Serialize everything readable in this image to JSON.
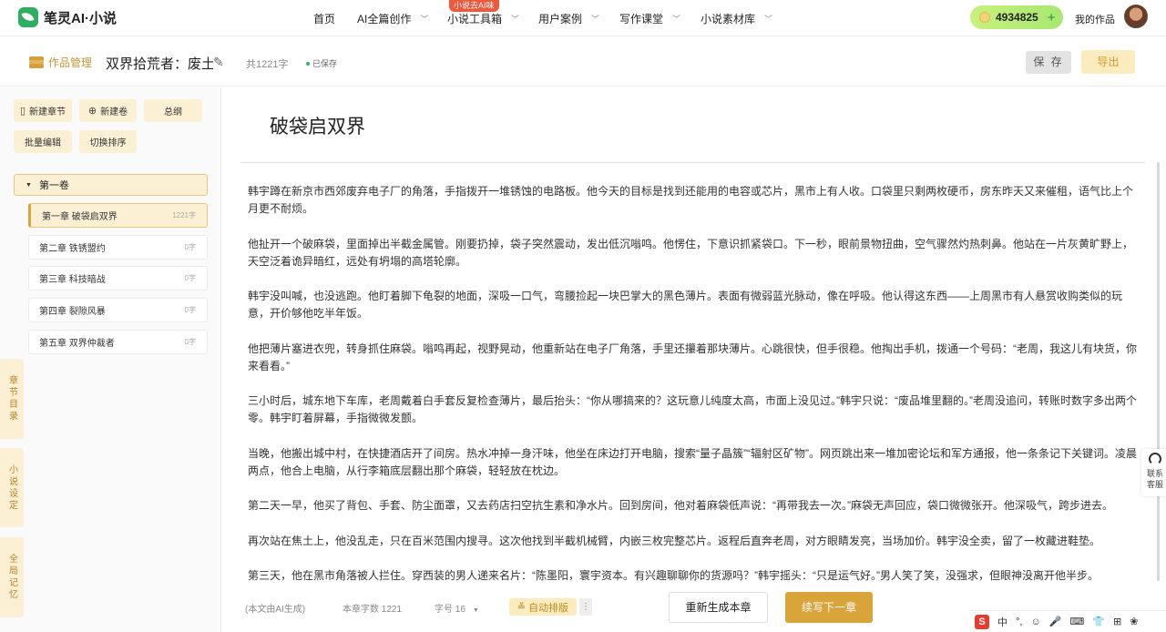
{
  "app": {
    "name": "笔灵AI·小说"
  },
  "nav": {
    "items": [
      {
        "label": "首页"
      },
      {
        "label": "AI全篇创作"
      },
      {
        "label": "小说工具箱"
      },
      {
        "label": "用户案例"
      },
      {
        "label": "写作课堂"
      },
      {
        "label": "小说素材库"
      }
    ],
    "badge": "小说去AI味",
    "coins": "4934825",
    "my_works": "我的作品"
  },
  "toolbar": {
    "works_manager": "作品管理",
    "doc_title": "双界拾荒者：废土商",
    "word_total": "共1221字",
    "saved": "已保存",
    "save": "保 存",
    "export": "导出"
  },
  "sidebar": {
    "buttons": {
      "new_chapter": "新建章节",
      "new_volume": "新建卷",
      "outline": "总纲",
      "batch_edit": "批量编辑",
      "toggle_sort": "切换排序"
    },
    "volume": "第一卷",
    "chapters": [
      {
        "name": "第一章 破袋启双界",
        "count": "1221字"
      },
      {
        "name": "第二章 铁锈盟约",
        "count": "0字"
      },
      {
        "name": "第三章 科技暗战",
        "count": "0字"
      },
      {
        "name": "第四章 裂隙风暴",
        "count": "0字"
      },
      {
        "name": "第五章 双界仲裁者",
        "count": "0字"
      }
    ]
  },
  "side_tabs": {
    "chapter_list": "章节目录",
    "novel_settings": "小说设定",
    "global_memory": "全局记忆"
  },
  "editor": {
    "chapter_title": "破袋启双界",
    "paragraphs": [
      "韩宇蹲在新京市西郊废弃电子厂的角落，手指拨开一堆锈蚀的电路板。他今天的目标是找到还能用的电容或芯片，黑市上有人收。口袋里只剩两枚硬币，房东昨天又来催租，语气比上个月更不耐烦。",
      "他扯开一个破麻袋，里面掉出半截金属管。刚要扔掉，袋子突然震动，发出低沉嗡鸣。他愣住，下意识抓紧袋口。下一秒，眼前景物扭曲，空气骤然灼热刺鼻。他站在一片灰黄旷野上，天空泛着诡异暗红，远处有坍塌的高塔轮廓。",
      "韩宇没叫喊，也没逃跑。他盯着脚下龟裂的地面，深吸一口气，弯腰捡起一块巴掌大的黑色薄片。表面有微弱蓝光脉动，像在呼吸。他认得这东西——上周黑市有人悬赏收购类似的玩意，开价够他吃半年饭。",
      "他把薄片塞进衣兜，转身抓住麻袋。嗡鸣再起，视野晃动，他重新站在电子厂角落，手里还攥着那块薄片。心跳很快，但手很稳。他掏出手机，拨通一个号码：“老周，我这儿有块货，你来看看。”",
      "三小时后，城东地下车库，老周戴着白手套反复检查薄片，最后抬头：“你从哪搞来的？这玩意儿纯度太高，市面上没见过。”韩宇只说：“废品堆里翻的。”老周没追问，转账时数字多出两个零。韩宇盯着屏幕，手指微微发颤。",
      "当晚，他搬出城中村，在快捷酒店开了间房。热水冲掉一身汗味，他坐在床边打开电脑，搜索“量子晶簇”“辐射区矿物”。网页跳出来一堆加密论坛和军方通报，他一条条记下关键词。凌晨两点，他合上电脑，从行李箱底层翻出那个麻袋，轻轻放在枕边。",
      "第二天一早，他买了背包、手套、防尘面罩，又去药店扫空抗生素和净水片。回到房间，他对着麻袋低声说：“再带我去一次。”麻袋无声回应，袋口微微张开。他深吸气，跨步进去。",
      "再次站在焦土上，他没乱走，只在百米范围内搜寻。这次他找到半截机械臂，内嵌三枚完整芯片。返程后直奔老周，对方眼睛发亮，当场加价。韩宇没全卖，留了一枚藏进鞋垫。",
      "第三天，他在黑市角落被人拦住。穿西装的男人递来名片：“陈墨阳，寰宇资本。有兴趣聊聊你的货源吗？”韩宇摇头：“只是运气好。”男人笑了笑，没强求，但眼神没离开他半步。"
    ]
  },
  "contact": {
    "label": "联系客服"
  },
  "bottom": {
    "ai_note": "(本文由AI生成)",
    "word_count": "本章字数 1221",
    "font_size": "字号 16",
    "auto_layout": "自动排版",
    "more": "⋮",
    "regenerate": "重新生成本章",
    "continue": "续写下一章"
  },
  "ime": {
    "items": [
      "中",
      "°,",
      "☺",
      "🎤",
      "⌨",
      "👕",
      "⊞",
      "❀"
    ]
  }
}
